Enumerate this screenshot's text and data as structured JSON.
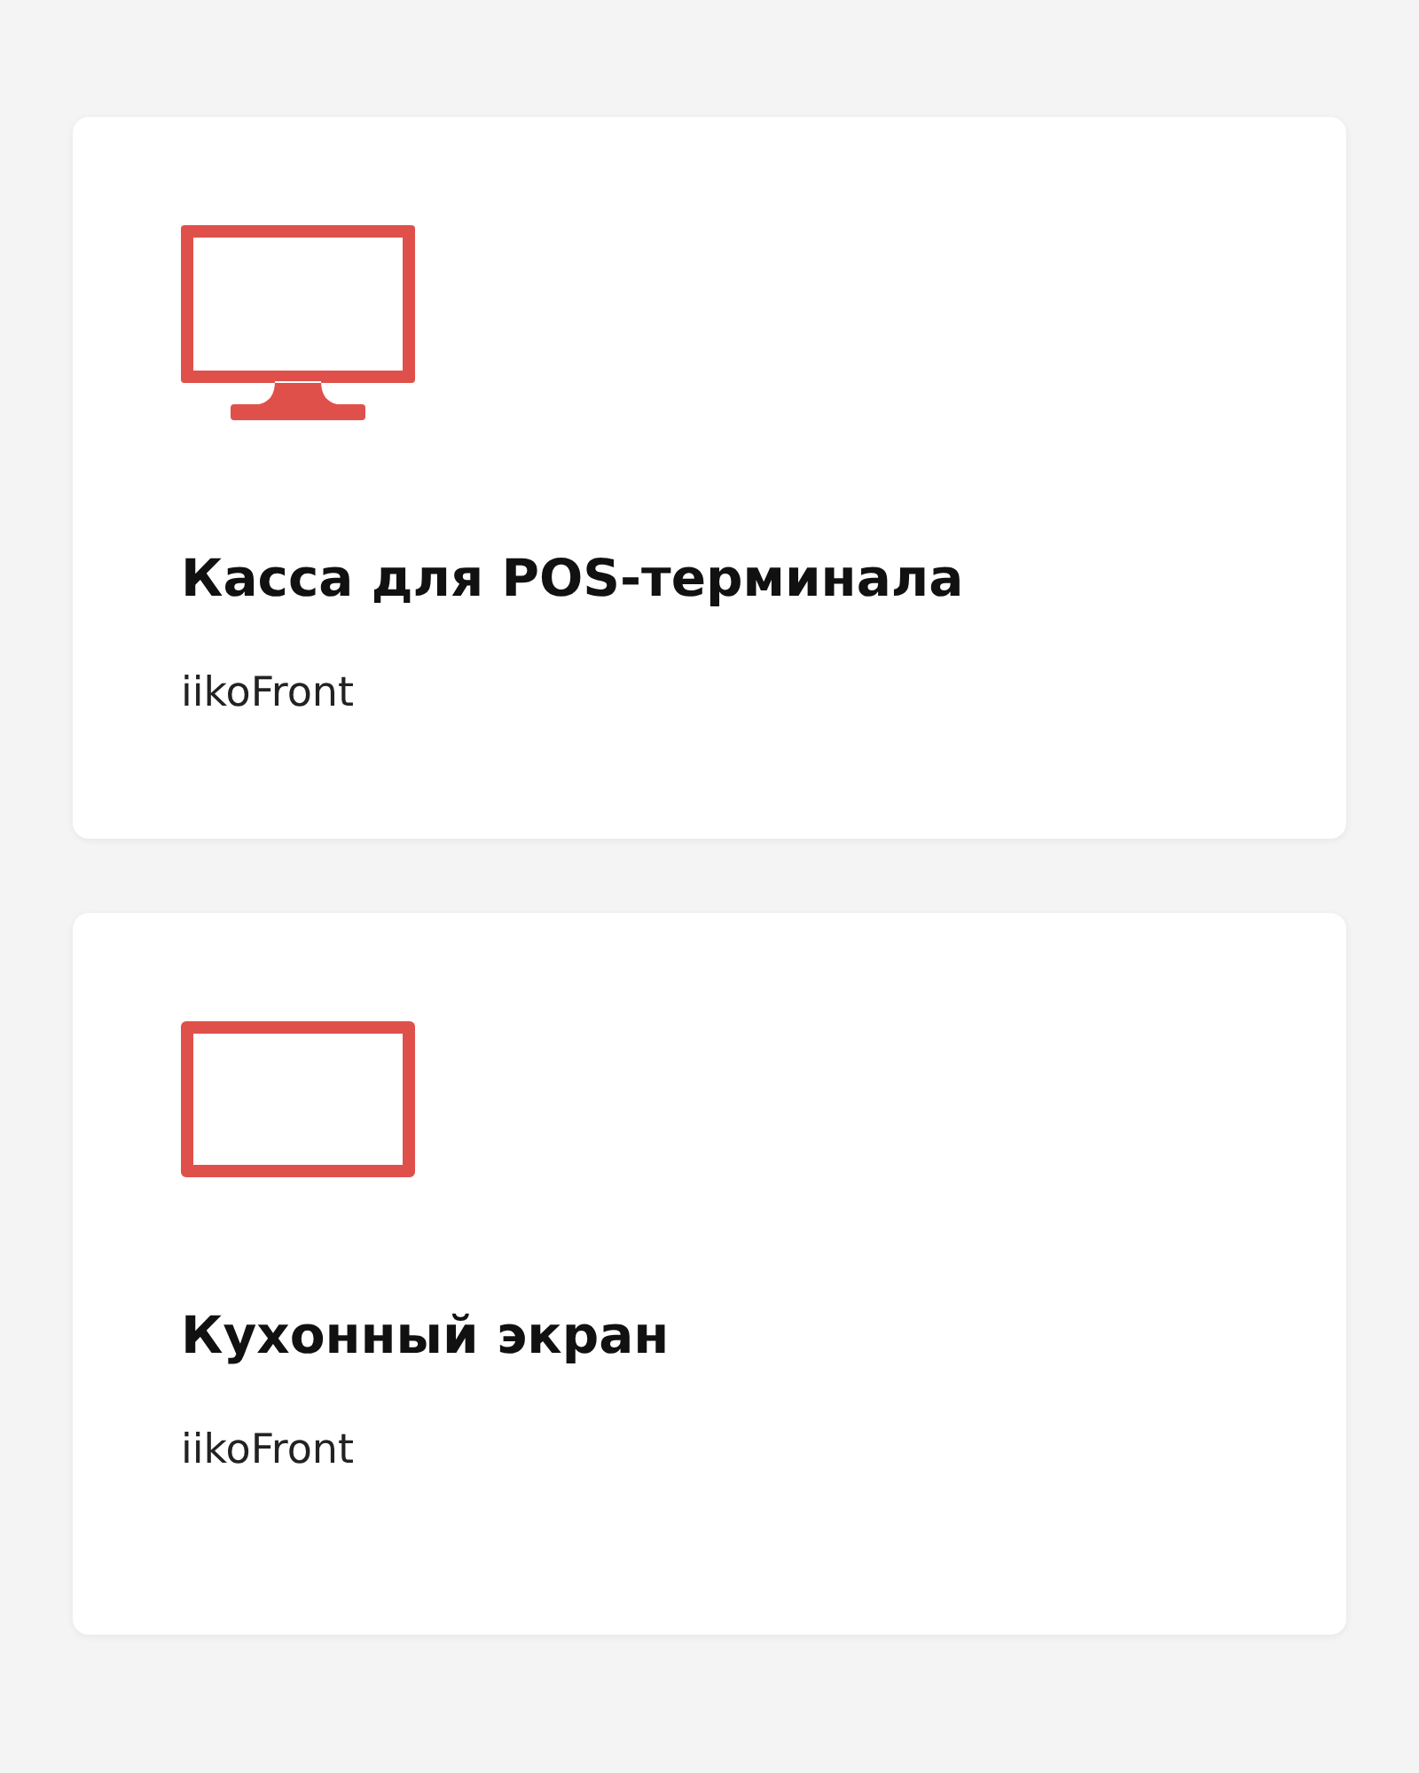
{
  "cards": [
    {
      "kind": "monitor",
      "title": "Касса для POS-терминала",
      "subtitle": "iikoFront"
    },
    {
      "kind": "screen",
      "title": "Кухонный экран",
      "subtitle": "iikoFront"
    }
  ]
}
